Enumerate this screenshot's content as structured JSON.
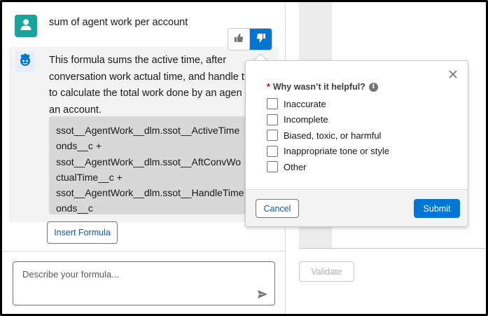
{
  "conversation": {
    "user_message": "sum of agent work per account",
    "ai_response_lines": [
      "This formula sums the active time, after",
      "conversation work actual time, and handle t",
      "to calculate the total work done by an agen",
      "an account."
    ],
    "code_lines": [
      "ssot__AgentWork__dlm.ssot__ActiveTime",
      "onds__c +",
      "ssot__AgentWork__dlm.ssot__AftConvWo",
      "ctualTime__c +",
      "ssot__AgentWork__dlm.ssot__HandleTime",
      "onds__c"
    ],
    "insert_formula_label": "Insert Formula",
    "user_avatar_icon": "user-icon",
    "bot_avatar_icon": "einstein-bot-icon"
  },
  "composer": {
    "placeholder": "Describe your formula...",
    "send_icon": "send-icon"
  },
  "feedback": {
    "thumbs_up_icon": "thumbs-up-icon",
    "thumbs_down_icon": "thumbs-down-icon",
    "thumbs_down_selected": true
  },
  "feedback_popover": {
    "required_marker": "*",
    "question": "Why wasn’t it helpful?",
    "info_icon": "info-icon",
    "options": [
      "Inaccurate",
      "Incomplete",
      "Biased, toxic, or harmful",
      "Inappropriate tone or style",
      "Other"
    ],
    "cancel_label": "Cancel",
    "submit_label": "Submit",
    "close_icon": "close-icon"
  },
  "editor": {
    "validate_label": "Validate"
  },
  "colors": {
    "brand_blue": "#0176d3",
    "link_blue": "#0b5cab",
    "user_avatar": "#1aa39a",
    "required_red": "#ba0517"
  }
}
